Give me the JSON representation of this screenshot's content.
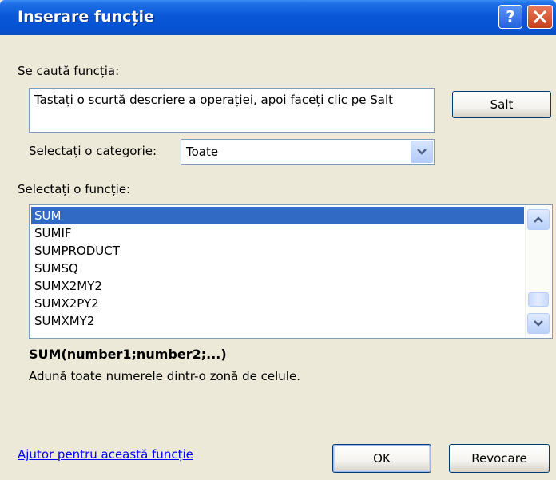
{
  "window": {
    "title": "Inserare funcție"
  },
  "titlebar": {
    "help_icon": "question-icon",
    "close_icon": "close-icon"
  },
  "search": {
    "label": "Se caută funcția:",
    "value": "Tastați o scurtă descriere a operației, apoi faceți clic pe Salt",
    "go_button": "Salt"
  },
  "category": {
    "label": "Selectați o categorie:",
    "selected": "Toate"
  },
  "functions": {
    "label": "Selectați o funcție:",
    "items": [
      "SUM",
      "SUMIF",
      "SUMPRODUCT",
      "SUMSQ",
      "SUMX2MY2",
      "SUMX2PY2",
      "SUMXMY2"
    ],
    "selected_index": 0,
    "signature": "SUM(number1;number2;...)",
    "description": "Adună toate numerele dintr-o zonă de celule."
  },
  "footer": {
    "help_link": "Ajutor pentru această funcție",
    "ok_button": "OK",
    "cancel_button": "Revocare"
  },
  "colors": {
    "titlebar": "#0a58d8",
    "dialog_bg": "#ece9d8",
    "selection": "#316ac5",
    "link": "#0000ff"
  }
}
